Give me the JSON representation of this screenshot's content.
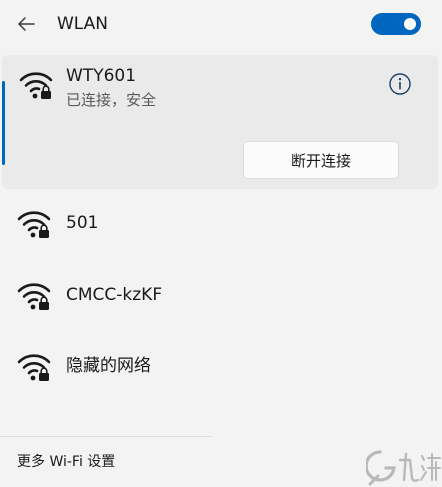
{
  "header": {
    "back_icon": "arrow-left-icon",
    "title": "WLAN",
    "toggle_on": true,
    "accent_color": "#0067c0"
  },
  "connected_network": {
    "name": "WTY601",
    "status": "已连接，安全",
    "icon": "wifi-secured-icon",
    "info_icon": "info-icon",
    "disconnect_label": "断开连接"
  },
  "networks": [
    {
      "name": "501",
      "icon": "wifi-secured-icon"
    },
    {
      "name": "CMCC-kzKF",
      "icon": "wifi-secured-icon"
    },
    {
      "name": "隐藏的网络",
      "icon": "wifi-secured-icon"
    }
  ],
  "footer": {
    "more_settings_label": "更多 Wi-Fi 设置"
  },
  "watermark": {
    "text": "九游"
  }
}
